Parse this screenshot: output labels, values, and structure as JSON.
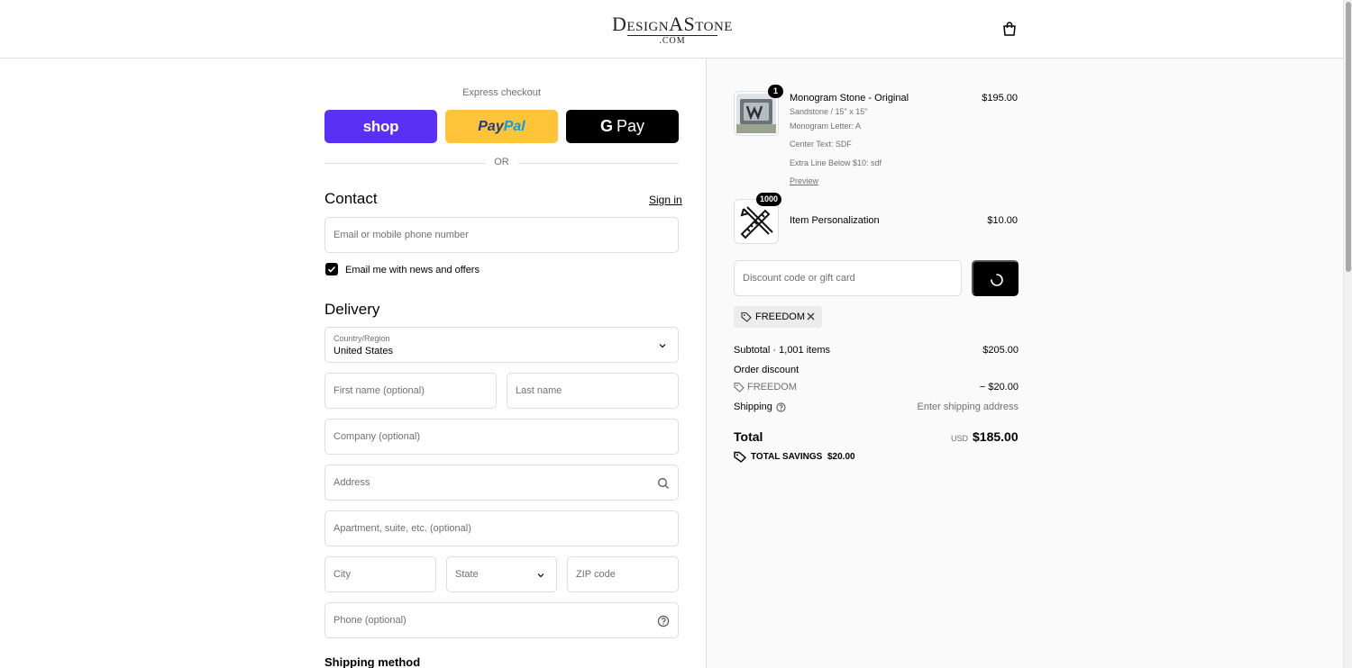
{
  "brand": {
    "logo_line1": "DesignAStone",
    "logo_line2": ".COM"
  },
  "express": {
    "label": "Express checkout",
    "shop_label": "shop",
    "paypal_part1": "Pay",
    "paypal_part2": "Pal",
    "gpay_g": "G",
    "gpay_label": "Pay",
    "or_label": "OR"
  },
  "contact": {
    "title": "Contact",
    "sign_in": "Sign in",
    "email_placeholder": "Email or mobile phone number",
    "newsletter_label": "Email me with news and offers",
    "newsletter_checked": true
  },
  "delivery": {
    "title": "Delivery",
    "country_label": "Country/Region",
    "country_value": "United States",
    "first_name_placeholder": "First name (optional)",
    "last_name_placeholder": "Last name",
    "company_placeholder": "Company (optional)",
    "address_placeholder": "Address",
    "apartment_placeholder": "Apartment, suite, etc. (optional)",
    "city_placeholder": "City",
    "state_placeholder": "State",
    "zip_placeholder": "ZIP code",
    "phone_placeholder": "Phone (optional)"
  },
  "shipping_method": {
    "title": "Shipping method"
  },
  "order": {
    "items": [
      {
        "name": "Monogram Stone - Original",
        "quantity": "1",
        "price": "$195.00",
        "details": [
          "Sandstone / 15\" x 15\"",
          "Monogram Letter: A",
          "Center Text: SDF",
          "Extra Line Below $10: sdf"
        ],
        "preview_link": "Preview"
      },
      {
        "name": "Item Personalization",
        "quantity": "1000",
        "price": "$10.00"
      }
    ],
    "discount_placeholder": "Discount code or gift card",
    "applied_code": "FREEDOM",
    "subtotal_label": "Subtotal · 1,001 items",
    "subtotal_value": "$205.00",
    "order_discount_label": "Order discount",
    "order_discount_code": "FREEDOM",
    "order_discount_value": "− $20.00",
    "shipping_label": "Shipping",
    "shipping_value": "Enter shipping address",
    "total_label": "Total",
    "total_currency": "USD",
    "total_value": "$185.00",
    "savings_label": "TOTAL SAVINGS",
    "savings_value": "$20.00"
  },
  "colors": {
    "shop_pay": "#5a31f4",
    "paypal": "#ffc439",
    "gpay": "#000000",
    "border": "#dedede",
    "summary_bg": "#fafafa",
    "muted_text": "#707070"
  }
}
